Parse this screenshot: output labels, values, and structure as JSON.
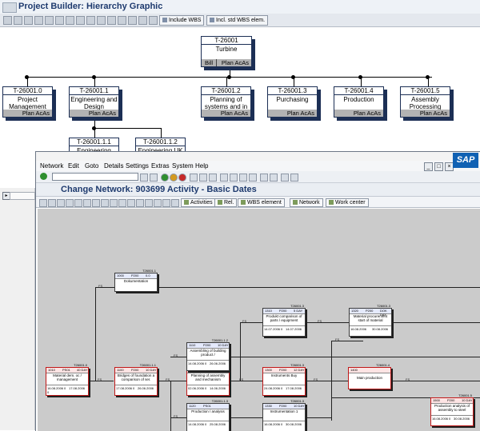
{
  "project_builder": {
    "title": "Project Builder: Hierarchy Graphic",
    "toolbar_buttons": [
      "Include WBS",
      "Incl. std WBS elem."
    ],
    "nodes": [
      {
        "id": "T-26001",
        "name": "Turbine",
        "bill": "Bill",
        "plan": "Plan AcAs"
      },
      {
        "id": "T-26001.0",
        "name": "Project Management",
        "plan": "Plan AcAs"
      },
      {
        "id": "T-26001.1",
        "name": "Engineering and Design",
        "plan": "Plan AcAs"
      },
      {
        "id": "T-26001.2",
        "name": "Planning of systems and in",
        "plan": "Plan AcAs"
      },
      {
        "id": "T-26001.3",
        "name": "Purchasing",
        "plan": "Plan AcAs"
      },
      {
        "id": "T-26001.4",
        "name": "Production",
        "plan": "Plan AcAs"
      },
      {
        "id": "T-26001.5",
        "name": "Assembly Processing",
        "plan": "Plan AcAs"
      },
      {
        "id": "T-26001.1.1",
        "name": "Engineering"
      },
      {
        "id": "T-26001.1.2",
        "name": "Engineering UK"
      }
    ]
  },
  "change_network": {
    "menu": [
      "Network",
      "Edit",
      "Goto",
      "Details",
      "Settings",
      "Extras",
      "System",
      "Help"
    ],
    "sap_logo": "SAP",
    "title": "Change Network: 903699 Activity - Basic Dates",
    "toolbar_buttons": [
      "Activities",
      "Rel.",
      "WBS element",
      "Network",
      "Work center"
    ],
    "activities": [
      {
        "nid": "T26001.1",
        "c1": "1000",
        "c2": "P200",
        "c3": "0.0",
        "name": "Dokumentation",
        "d1": "",
        "d2": "",
        "d3": "",
        "d4": "",
        "color": "blue"
      },
      {
        "nid": "T26001.0",
        "c1": "1010",
        "c2": "PS01",
        "c3": "40 DAY",
        "name": "Material dem. oc / management",
        "d1": "16.08.2006",
        "d2": "0",
        "d3": "17.08.2006",
        "d4": "0",
        "color": "red"
      },
      {
        "nid": "T26001.1.1",
        "c1": "1100",
        "c2": "P200",
        "c3": "10 DAY",
        "name": "Bridges of foundation a comparison of ser.",
        "d1": "17.08.2006",
        "d2": "0",
        "d3": "26.06.2006",
        "d4": "",
        "color": "red"
      },
      {
        "nid": "T26001.2.1",
        "c1": "1200",
        "c2": "P200",
        "c3": "10 DAY",
        "name": "Planning of assembly and mechanism",
        "d1": "02.06.2006",
        "d2": "0",
        "d3": "14.06.2006",
        "d4": "",
        "color": "red"
      },
      {
        "nid": "T26001.3",
        "c1": "1300",
        "c2": "P200",
        "c3": "12 DAY",
        "name": "Instruments Buy",
        "d1": "24.08.2006",
        "d2": "0",
        "d3": "17.08.2006",
        "d4": "",
        "color": "red"
      },
      {
        "nid": "T26001.4",
        "c1": "1400",
        "c2": "",
        "c3": "",
        "name": "Main production",
        "d1": "",
        "d2": "",
        "d3": "",
        "d4": "",
        "color": "red"
      },
      {
        "nid": "T26001.3",
        "c1": "1310",
        "c2": "P200",
        "c3": "5 DAY",
        "name": "Produkt comparison of parts / equipment",
        "d1": "14.07.2006",
        "d2": "0",
        "d3": "14.07.2006",
        "d4": "",
        "color": "blue"
      },
      {
        "nid": "T26001.3",
        "c1": "1320",
        "c2": "P200",
        "c3": "DOK DAY",
        "name": "Material procurement start of material",
        "d1": "16.08.2006",
        "d2": "",
        "d3": "30.08.2006",
        "d4": "",
        "color": "blue"
      },
      {
        "nid": "T26001.1.2",
        "c1": "1110",
        "c2": "P200",
        "c3": "10 DAY",
        "name": "Assembling of building product /",
        "d1": "14.08.2006",
        "d2": "0",
        "d3": "26.06.2006",
        "d4": "",
        "color": "blue"
      },
      {
        "nid": "T26001.1.3",
        "c1": "1120",
        "c2": "PS01",
        "c3": "",
        "name": "Production / analysis",
        "d1": "14.08.2006",
        "d2": "0",
        "d3": "25.08.2006",
        "d4": "",
        "color": "blue"
      },
      {
        "nid": "T26001.3",
        "c1": "1330",
        "c2": "P200",
        "c3": "10 DAY",
        "name": "Instrumentation 1",
        "d1": "16.08.2006",
        "d2": "0",
        "d3": "30.08.2006",
        "d4": "",
        "color": "blue"
      },
      {
        "nid": "T26001.5",
        "c1": "1500",
        "c2": "P200",
        "c3": "10 DAY",
        "name": "Production analysis of assembly to steel",
        "d1": "16.08.2006",
        "d2": "0",
        "d3": "30.08.2006",
        "d4": "",
        "color": "red"
      }
    ],
    "relations": [
      "FS",
      "FS",
      "FS",
      "FS",
      "FS",
      "FS",
      "FS",
      "FS",
      "FS",
      "FS",
      "FS"
    ]
  }
}
